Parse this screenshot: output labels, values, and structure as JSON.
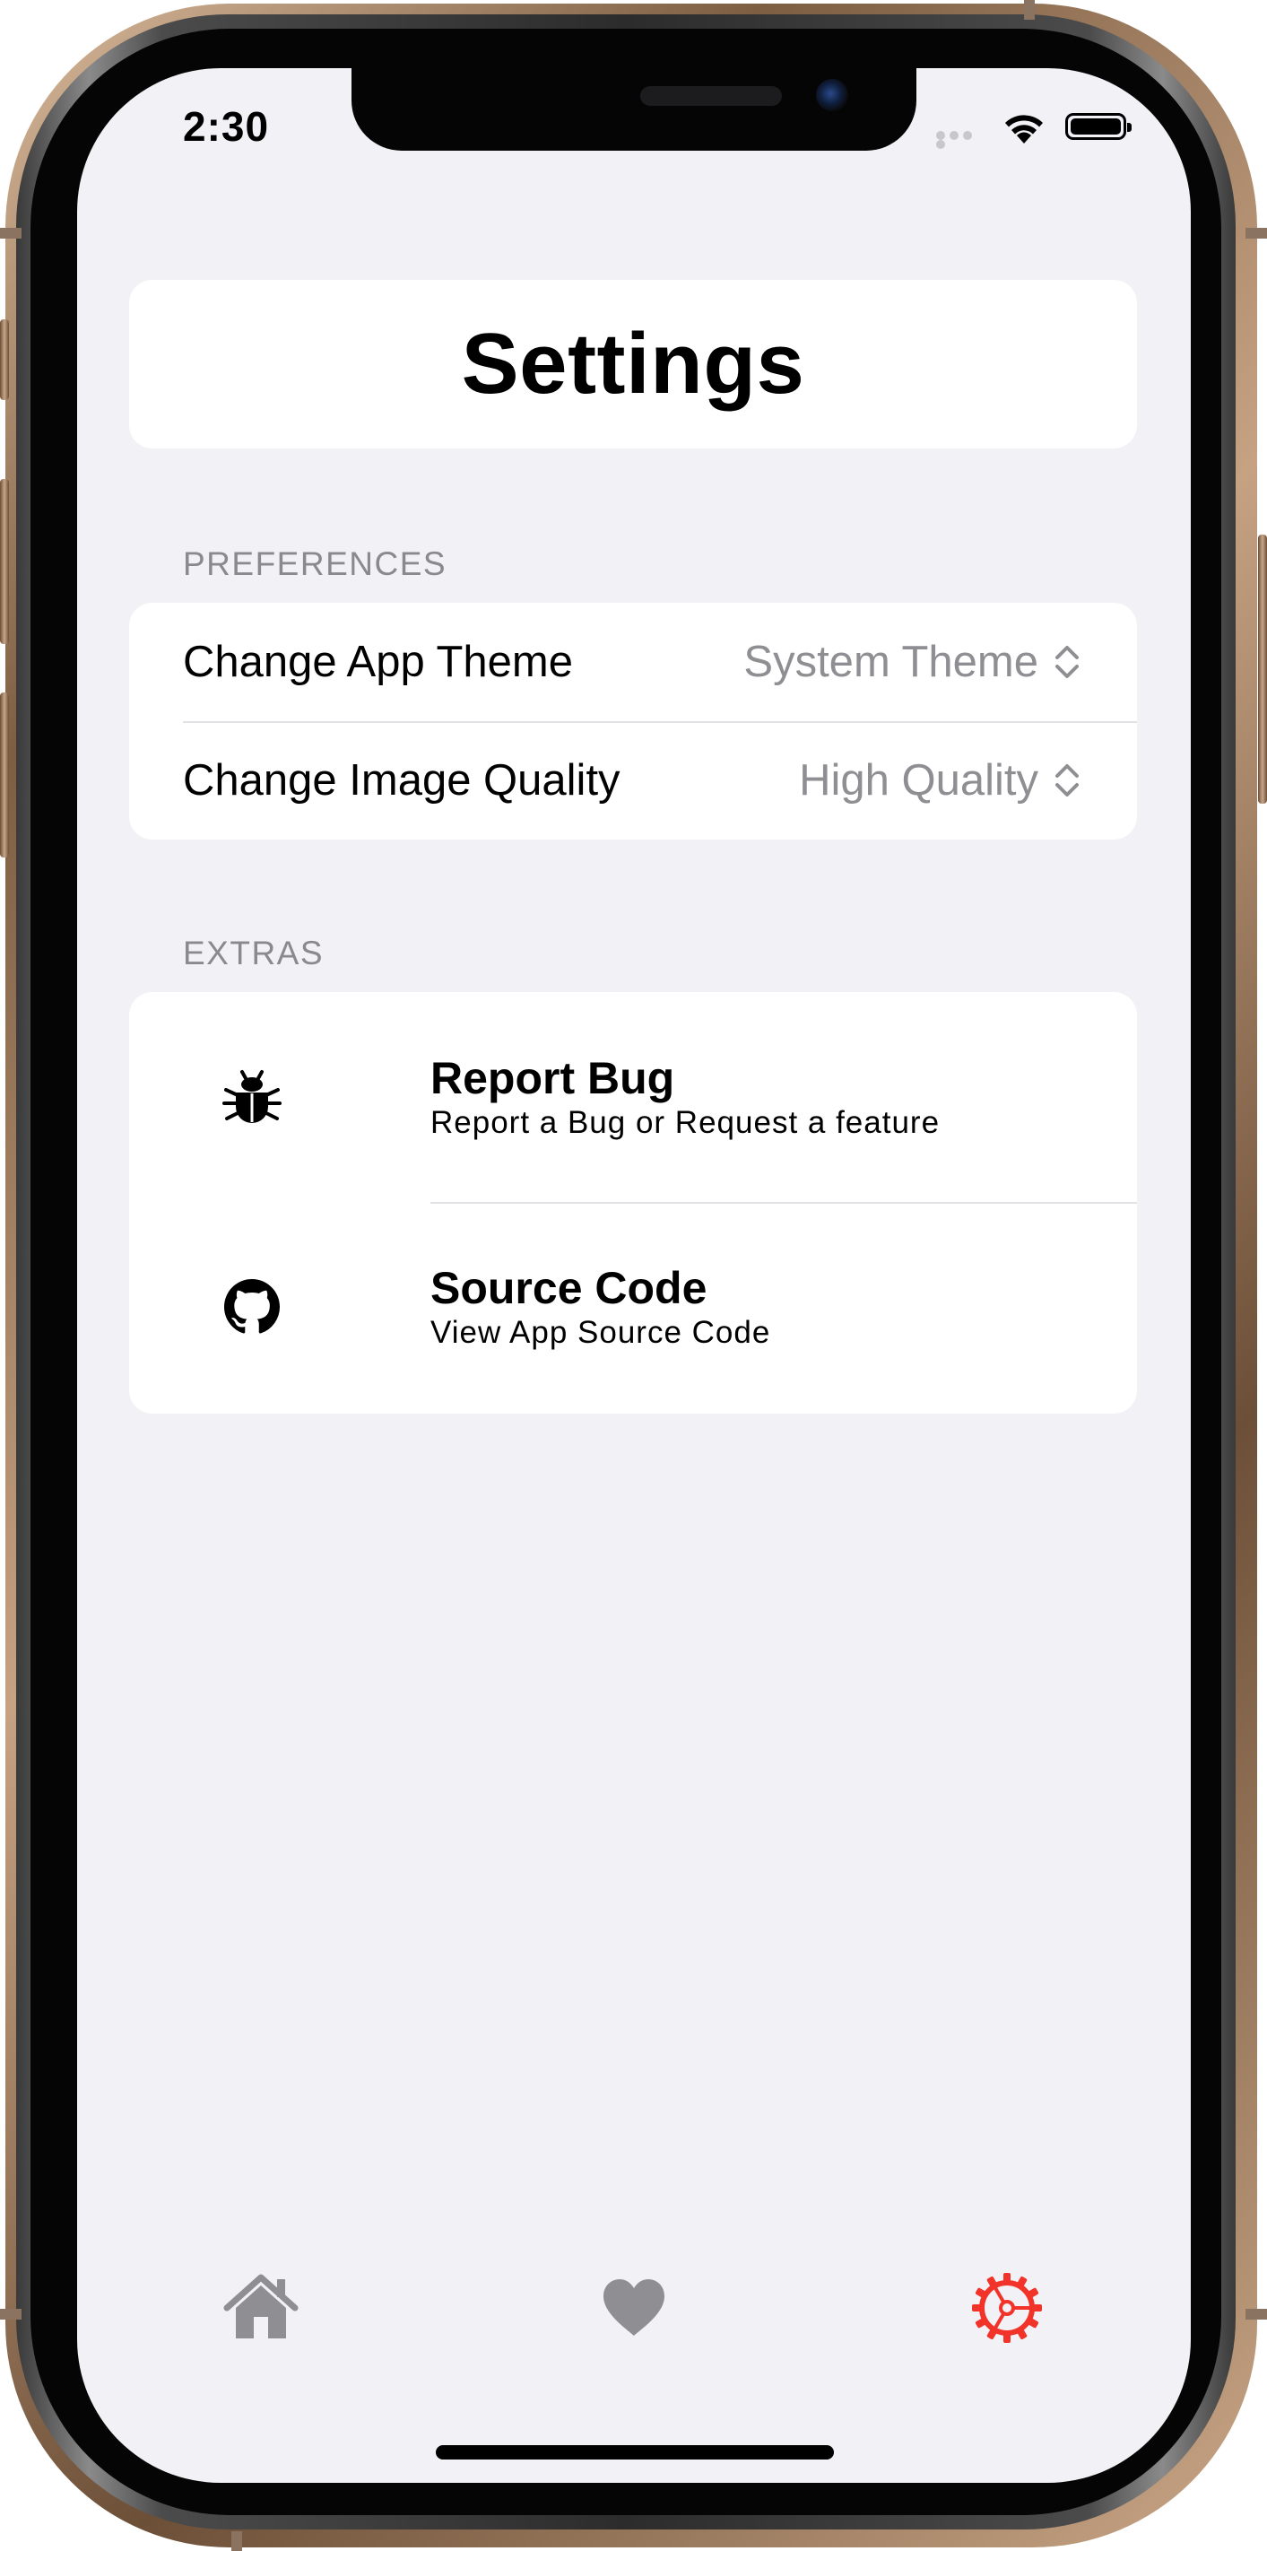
{
  "status_bar": {
    "time": "2:30"
  },
  "header": {
    "title": "Settings"
  },
  "preferences": {
    "section_title": "PREFERENCES",
    "rows": [
      {
        "label": "Change App Theme",
        "value": "System Theme"
      },
      {
        "label": "Change Image Quality",
        "value": "High Quality"
      }
    ]
  },
  "extras": {
    "section_title": "EXTRAS",
    "items": [
      {
        "title": "Report Bug",
        "subtitle": "Report a Bug or Request a feature",
        "icon": "bug-icon"
      },
      {
        "title": "Source Code",
        "subtitle": "View App Source Code",
        "icon": "github-icon"
      }
    ]
  },
  "tab_bar": {
    "tabs": [
      {
        "icon": "house-icon",
        "selected": false
      },
      {
        "icon": "heart-icon",
        "selected": false
      },
      {
        "icon": "gear-icon",
        "selected": true
      }
    ]
  },
  "colors": {
    "background": "#f2f1f6",
    "accent": "#f2332a",
    "inactive_tab": "#8e8e93",
    "secondary_text": "#8e8e93"
  }
}
